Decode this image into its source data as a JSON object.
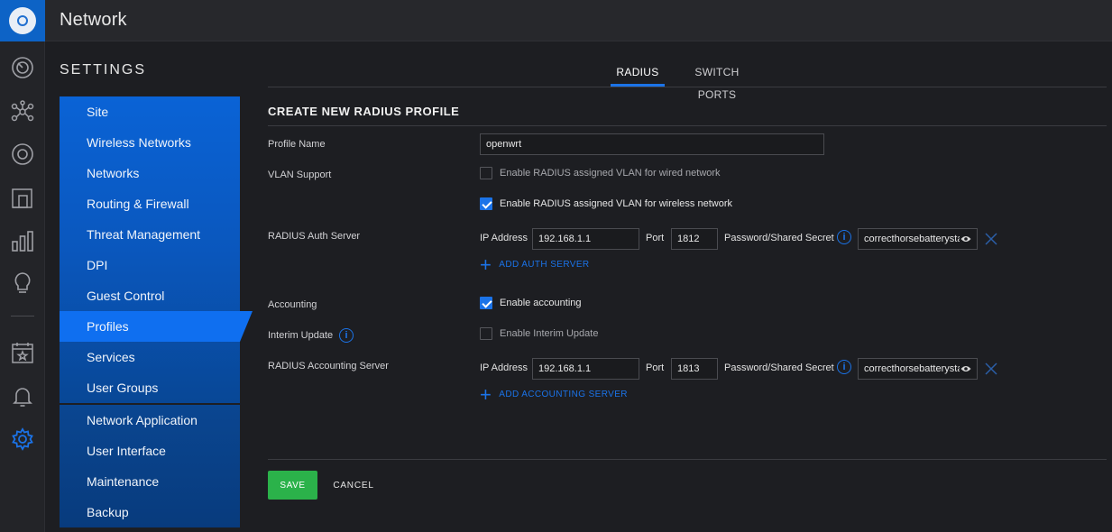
{
  "app": {
    "title": "Network",
    "logo_icon": "ubiquiti-logo-icon",
    "accent_color": "#1b73e8"
  },
  "rail": {
    "icons": [
      "dashboard-icon",
      "topology-icon",
      "devices-icon",
      "clients-icon",
      "statistics-icon",
      "insights-icon",
      "events-icon",
      "alerts-icon",
      "settings-icon"
    ],
    "active": "settings-icon"
  },
  "settings": {
    "heading": "SETTINGS",
    "nav_primary": [
      "Site",
      "Wireless Networks",
      "Networks",
      "Routing & Firewall",
      "Threat Management",
      "DPI",
      "Guest Control",
      "Profiles",
      "Services",
      "User Groups"
    ],
    "nav_secondary": [
      "Network Application",
      "User Interface",
      "Maintenance",
      "Backup"
    ],
    "active_item": "Profiles"
  },
  "tabs": {
    "radius": "RADIUS",
    "switch_ports": "SWITCH PORTS",
    "active": "RADIUS"
  },
  "form": {
    "title": "CREATE NEW RADIUS PROFILE",
    "profile_name_label": "Profile Name",
    "profile_name_value": "openwrt",
    "vlan_label": "VLAN Support",
    "vlan_wired_label": "Enable RADIUS assigned VLAN for wired network",
    "vlan_wired_checked": false,
    "vlan_wireless_label": "Enable RADIUS assigned VLAN for wireless network",
    "vlan_wireless_checked": true,
    "auth_server_label": "RADIUS Auth Server",
    "auth": {
      "ip_label": "IP Address",
      "ip_value": "192.168.1.1",
      "port_label": "Port",
      "port_value": "1812",
      "secret_label": "Password/Shared Secret",
      "secret_value": "correcthorsebatterystaple"
    },
    "add_auth_label": "ADD AUTH SERVER",
    "accounting_label": "Accounting",
    "accounting_enable_label": "Enable accounting",
    "accounting_checked": true,
    "interim_label": "Interim Update",
    "interim_enable_label": "Enable Interim Update",
    "interim_checked": false,
    "acct_server_label": "RADIUS Accounting Server",
    "acct": {
      "ip_label": "IP Address",
      "ip_value": "192.168.1.1",
      "port_label": "Port",
      "port_value": "1813",
      "secret_label": "Password/Shared Secret",
      "secret_value": "correcthorsebatterystaple"
    },
    "add_acct_label": "ADD ACCOUNTING SERVER",
    "save_label": "SAVE",
    "cancel_label": "CANCEL",
    "save_color": "#2bb24a"
  }
}
